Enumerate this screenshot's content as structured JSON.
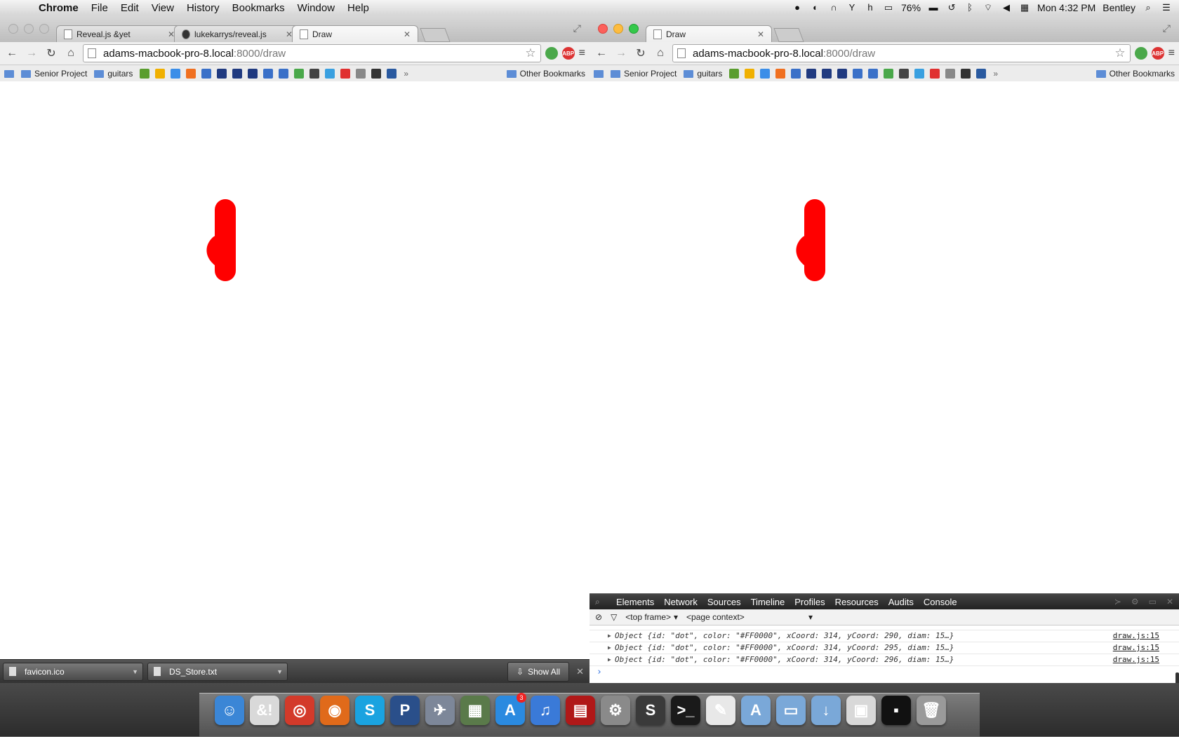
{
  "menubar": {
    "app": "Chrome",
    "items": [
      "File",
      "Edit",
      "View",
      "History",
      "Bookmarks",
      "Window",
      "Help"
    ],
    "battery": "76%",
    "clock": "Mon 4:32 PM",
    "user": "Bentley"
  },
  "left_window": {
    "tabs": [
      {
        "label": "Reveal.js &yet"
      },
      {
        "label": "lukekarrys/reveal.js"
      },
      {
        "label": "Draw"
      }
    ],
    "url_host": "adams-macbook-pro-8.local",
    "url_rest": ":8000/draw"
  },
  "right_window": {
    "tabs": [
      {
        "label": "Draw"
      }
    ],
    "url_host": "adams-macbook-pro-8.local",
    "url_rest": ":8000/draw"
  },
  "bookmarks": {
    "folder1": "Senior Project",
    "folder2": "guitars",
    "other": "Other Bookmarks",
    "icon_colors": [
      "#5a9d2e",
      "#f0b000",
      "#3b8ee8",
      "#f07020",
      "#3a70c8",
      "#203a80",
      "#203a80",
      "#203a80",
      "#3a70c8",
      "#3a70c8",
      "#4aa84a",
      "#444",
      "#3aa0e0",
      "#e03030",
      "#888",
      "#333",
      "#2a5aa0"
    ]
  },
  "drawing": {
    "color": "#FF0000"
  },
  "downloads": {
    "items": [
      "favicon.ico",
      "DS_Store.txt"
    ],
    "show_all": "Show All"
  },
  "devtools": {
    "tabs": [
      "Elements",
      "Network",
      "Sources",
      "Timeline",
      "Profiles",
      "Resources",
      "Audits",
      "Console"
    ],
    "frame": "<top frame>",
    "context": "<page context>",
    "rows": [
      {
        "tail": "Object {id: \"dot\", color: \"#FF0000\", xCoord: 314, yCoord: 290, diam: 15…}",
        "src": "draw.js:15"
      },
      {
        "tail": "Object {id: \"dot\", color: \"#FF0000\", xCoord: 314, yCoord: 295, diam: 15…}",
        "src": "draw.js:15"
      },
      {
        "tail": "Object {id: \"dot\", color: \"#FF0000\", xCoord: 314, yCoord: 296, diam: 15…}",
        "src": "draw.js:15"
      }
    ],
    "prompt": "›"
  },
  "dock": {
    "apps": [
      {
        "name": "finder",
        "glyph": "☺",
        "color": "#3b86d6"
      },
      {
        "name": "andyet",
        "glyph": "&!",
        "color": "#d9d9d9"
      },
      {
        "name": "chrome",
        "glyph": "◎",
        "color": "#d33a2a"
      },
      {
        "name": "firefox",
        "glyph": "◉",
        "color": "#e06a1a"
      },
      {
        "name": "skype",
        "glyph": "S",
        "color": "#1aa3e0"
      },
      {
        "name": "pandora",
        "glyph": "P",
        "color": "#2a4f8a"
      },
      {
        "name": "launchpad",
        "glyph": "✈",
        "color": "#7d8799"
      },
      {
        "name": "preview",
        "glyph": "▦",
        "color": "#5a7a4a"
      },
      {
        "name": "appstore",
        "glyph": "A",
        "color": "#2a8ae0",
        "badge": "3"
      },
      {
        "name": "itunes",
        "glyph": "♫",
        "color": "#3a7ad8"
      },
      {
        "name": "photobooth",
        "glyph": "▤",
        "color": "#b01818"
      },
      {
        "name": "systemprefs",
        "glyph": "⚙",
        "color": "#8a8a8a"
      },
      {
        "name": "sublime",
        "glyph": "S",
        "color": "#3a3a3a"
      },
      {
        "name": "terminal",
        "glyph": ">_",
        "color": "#1a1a1a"
      },
      {
        "name": "textedit",
        "glyph": "✎",
        "color": "#e8e8e8"
      },
      {
        "name": "applications",
        "glyph": "A",
        "color": "#7aa8d8"
      },
      {
        "name": "documents",
        "glyph": "▭",
        "color": "#7aa8d8"
      },
      {
        "name": "downloads",
        "glyph": "↓",
        "color": "#7aa8d8"
      },
      {
        "name": "chrome-window",
        "glyph": "▣",
        "color": "#d8d8d8"
      },
      {
        "name": "terminal-window",
        "glyph": "▪",
        "color": "#111"
      },
      {
        "name": "trash",
        "glyph": "🗑",
        "color": "#9a9a9a"
      }
    ]
  }
}
